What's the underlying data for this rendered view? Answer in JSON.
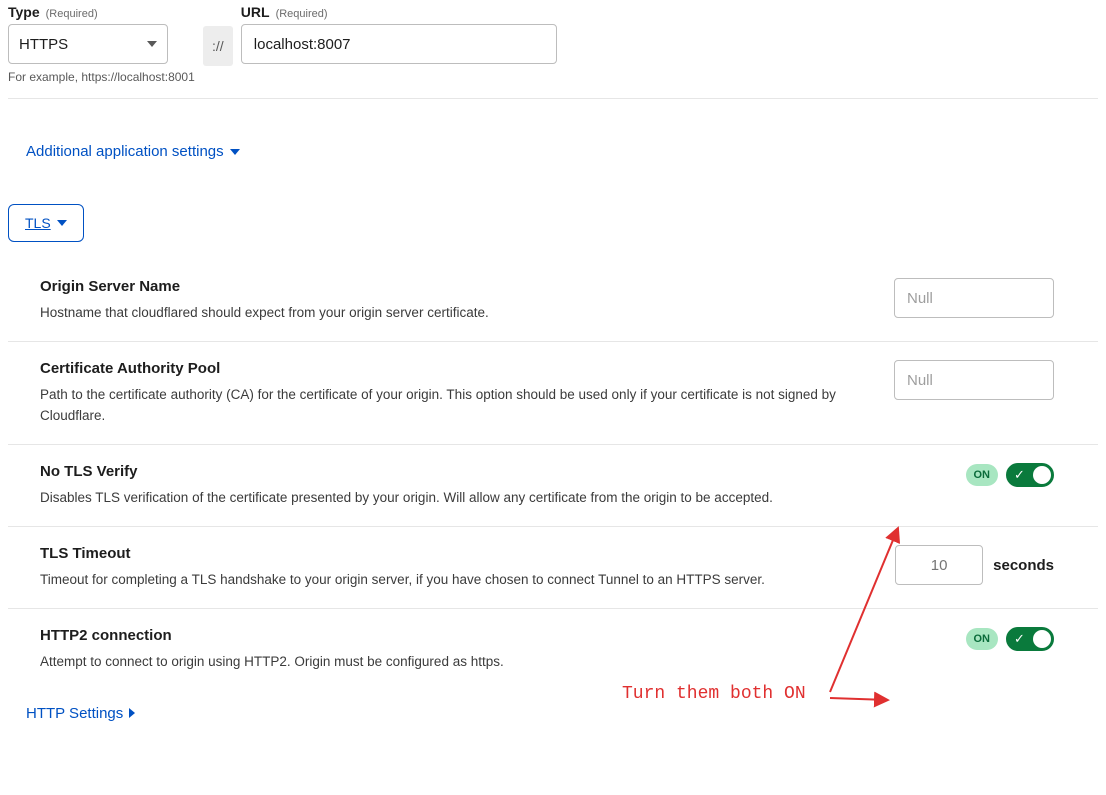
{
  "top": {
    "type_label": "Type",
    "url_label": "URL",
    "required": "(Required)",
    "type_value": "HTTPS",
    "proto_sep": "://",
    "url_value": "localhost:8007",
    "example": "For example, https://localhost:8001"
  },
  "links": {
    "additional": "Additional application settings",
    "tls": "TLS",
    "http_settings": "HTTP Settings"
  },
  "settings": {
    "origin": {
      "title": "Origin Server Name",
      "desc": "Hostname that cloudflared should expect from your origin server certificate.",
      "placeholder": "Null"
    },
    "ca": {
      "title": "Certificate Authority Pool",
      "desc": "Path to the certificate authority (CA) for the certificate of your origin. This option should be used only if your certificate is not signed by Cloudflare.",
      "placeholder": "Null"
    },
    "notls": {
      "title": "No TLS Verify",
      "desc": "Disables TLS verification of the certificate presented by your origin. Will allow any certificate from the origin to be accepted.",
      "badge": "ON"
    },
    "timeout": {
      "title": "TLS Timeout",
      "desc": "Timeout for completing a TLS handshake to your origin server, if you have chosen to connect Tunnel to an HTTPS server.",
      "value": "10",
      "unit": "seconds"
    },
    "http2": {
      "title": "HTTP2 connection",
      "desc": "Attempt to connect to origin using HTTP2. Origin must be configured as https.",
      "badge": "ON"
    }
  },
  "annotation": {
    "text": "Turn them both ON"
  }
}
